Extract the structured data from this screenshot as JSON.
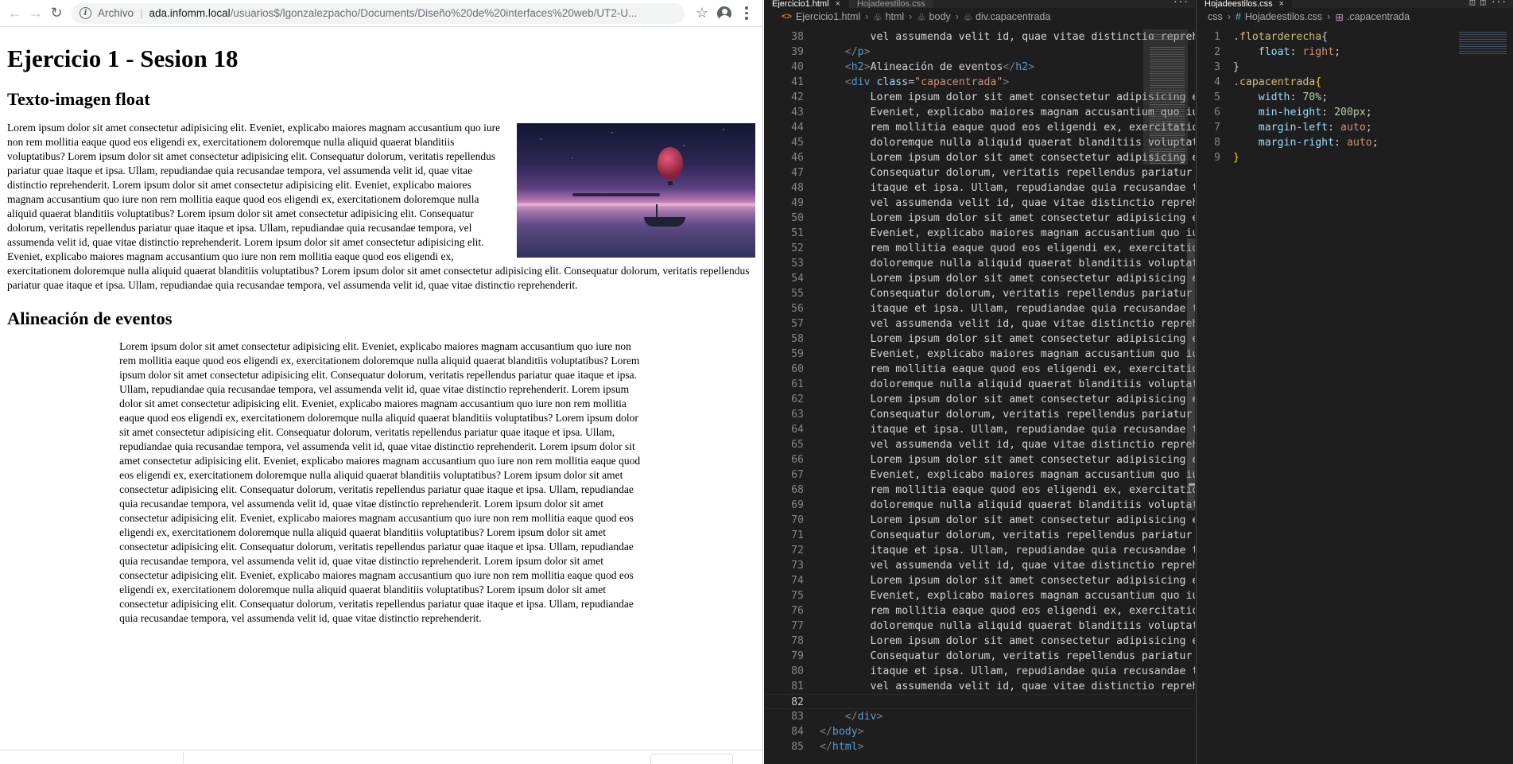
{
  "browser": {
    "scheme_label": "Archivo",
    "url_host": "ada.infomm.local",
    "url_path": "/usuarios$/lgonzalezpacho/Documents/Diseño%20de%20interfaces%20web/UT2-U...",
    "page": {
      "title": "Ejercicio 1 - Sesion 18",
      "section1_heading": "Texto-imagen float",
      "section1_text": "Lorem ipsum dolor sit amet consectetur adipisicing elit. Eveniet, explicabo maiores magnam accusantium quo iure non rem mollitia eaque quod eos eligendi ex, exercitationem doloremque nulla aliquid quaerat blanditiis voluptatibus? Lorem ipsum dolor sit amet consectetur adipisicing elit. Consequatur dolorum, veritatis repellendus pariatur quae itaque et ipsa. Ullam, repudiandae quia recusandae tempora, vel assumenda velit id, quae vitae distinctio reprehenderit. Lorem ipsum dolor sit amet consectetur adipisicing elit. Eveniet, explicabo maiores magnam accusantium quo iure non rem mollitia eaque quod eos eligendi ex, exercitationem doloremque nulla aliquid quaerat blanditiis voluptatibus? Lorem ipsum dolor sit amet consectetur adipisicing elit. Consequatur dolorum, veritatis repellendus pariatur quae itaque et ipsa. Ullam, repudiandae quia recusandae tempora, vel assumenda velit id, quae vitae distinctio reprehenderit. Lorem ipsum dolor sit amet consectetur adipisicing elit. Eveniet, explicabo maiores magnam accusantium quo iure non rem mollitia eaque quod eos eligendi ex, exercitationem doloremque nulla aliquid quaerat blanditiis voluptatibus? Lorem ipsum dolor sit amet consectetur adipisicing elit. Consequatur dolorum, veritatis repellendus pariatur quae itaque et ipsa. Ullam, repudiandae quia recusandae tempora, vel assumenda velit id, quae vitae distinctio reprehenderit.",
      "section2_heading": "Alineación de eventos",
      "section2_text": "Lorem ipsum dolor sit amet consectetur adipisicing elit. Eveniet, explicabo maiores magnam accusantium quo iure non rem mollitia eaque quod eos eligendi ex, exercitationem doloremque nulla aliquid quaerat blanditiis voluptatibus? Lorem ipsum dolor sit amet consectetur adipisicing elit. Consequatur dolorum, veritatis repellendus pariatur quae itaque et ipsa. Ullam, repudiandae quia recusandae tempora, vel assumenda velit id, quae vitae distinctio reprehenderit. Lorem ipsum dolor sit amet consectetur adipisicing elit. Eveniet, explicabo maiores magnam accusantium quo iure non rem mollitia eaque quod eos eligendi ex, exercitationem doloremque nulla aliquid quaerat blanditiis voluptatibus? Lorem ipsum dolor sit amet consectetur adipisicing elit. Consequatur dolorum, veritatis repellendus pariatur quae itaque et ipsa. Ullam, repudiandae quia recusandae tempora, vel assumenda velit id, quae vitae distinctio reprehenderit. Lorem ipsum dolor sit amet consectetur adipisicing elit. Eveniet, explicabo maiores magnam accusantium quo iure non rem mollitia eaque quod eos eligendi ex, exercitationem doloremque nulla aliquid quaerat blanditiis voluptatibus? Lorem ipsum dolor sit amet consectetur adipisicing elit. Consequatur dolorum, veritatis repellendus pariatur quae itaque et ipsa. Ullam, repudiandae quia recusandae tempora, vel assumenda velit id, quae vitae distinctio reprehenderit. Lorem ipsum dolor sit amet consectetur adipisicing elit. Eveniet, explicabo maiores magnam accusantium quo iure non rem mollitia eaque quod eos eligendi ex, exercitationem doloremque nulla aliquid quaerat blanditiis voluptatibus? Lorem ipsum dolor sit amet consectetur adipisicing elit. Consequatur dolorum, veritatis repellendus pariatur quae itaque et ipsa. Ullam, repudiandae quia recusandae tempora, vel assumenda velit id, quae vitae distinctio reprehenderit. Lorem ipsum dolor sit amet consectetur adipisicing elit. Eveniet, explicabo maiores magnam accusantium quo iure non rem mollitia eaque quod eos eligendi ex, exercitationem doloremque nulla aliquid quaerat blanditiis voluptatibus? Lorem ipsum dolor sit amet consectetur adipisicing elit. Consequatur dolorum, veritatis repellendus pariatur quae itaque et ipsa. Ullam, repudiandae quia recusandae tempora, vel assumenda velit id, quae vitae distinctio reprehenderit."
    }
  },
  "editor_left": {
    "tabs": [
      {
        "label": "Ejercicio1.html",
        "active": true
      },
      {
        "label": "Hojadeestilos.css",
        "active": false
      }
    ],
    "breadcrumb": {
      "file": "Ejercicio1.html",
      "c1": "html",
      "c2": "body",
      "c3": "div.capacentrada"
    },
    "lines": [
      {
        "n": "38",
        "tokens": [
          [
            "        vel assumenda velit id, quae vitae distinctio reprehenderit.",
            ""
          ]
        ]
      },
      {
        "n": "39",
        "tokens": [
          [
            "    ",
            ""
          ],
          [
            "</",
            "punc"
          ],
          [
            "p",
            "tag"
          ],
          [
            ">",
            "punc"
          ]
        ]
      },
      {
        "n": "40",
        "tokens": [
          [
            "    ",
            ""
          ],
          [
            "<",
            "punc"
          ],
          [
            "h2",
            "tag"
          ],
          [
            ">",
            "punc"
          ],
          [
            "Alineación de eventos",
            ""
          ],
          [
            "</",
            "punc"
          ],
          [
            "h2",
            "tag"
          ],
          [
            ">",
            "punc"
          ]
        ]
      },
      {
        "n": "41",
        "tokens": [
          [
            "    ",
            ""
          ],
          [
            "<",
            "punc"
          ],
          [
            "div",
            "tag"
          ],
          [
            " class",
            "attr"
          ],
          [
            "=",
            ""
          ],
          [
            "\"capacentrada\"",
            "str"
          ],
          [
            ">",
            "punc"
          ]
        ]
      },
      {
        "n": "42",
        "tokens": [
          [
            "        Lorem ipsum dolor sit amet consectetur adipisicing elit.",
            ""
          ]
        ]
      },
      {
        "n": "43",
        "tokens": [
          [
            "        Eveniet, explicabo maiores magnam accusantium quo iure non",
            ""
          ]
        ]
      },
      {
        "n": "44",
        "tokens": [
          [
            "        rem mollitia eaque quod eos eligendi ex, exercitationem",
            ""
          ]
        ]
      },
      {
        "n": "45",
        "tokens": [
          [
            "        doloremque nulla aliquid quaerat blanditiis voluptatibus?",
            ""
          ]
        ]
      },
      {
        "n": "46",
        "tokens": [
          [
            "        Lorem ipsum dolor sit amet consectetur adipisicing elit.",
            ""
          ]
        ]
      },
      {
        "n": "47",
        "tokens": [
          [
            "        Consequatur dolorum, veritatis repellendus pariatur quae",
            ""
          ]
        ]
      },
      {
        "n": "48",
        "tokens": [
          [
            "        itaque et ipsa. Ullam, repudiandae quia recusandae tempora,",
            ""
          ]
        ]
      },
      {
        "n": "49",
        "tokens": [
          [
            "        vel assumenda velit id, quae vitae distinctio reprehenderit.",
            ""
          ]
        ]
      },
      {
        "n": "50",
        "tokens": [
          [
            "        Lorem ipsum dolor sit amet consectetur adipisicing elit.",
            ""
          ]
        ]
      },
      {
        "n": "51",
        "tokens": [
          [
            "        Eveniet, explicabo maiores magnam accusantium quo iure non",
            ""
          ]
        ]
      },
      {
        "n": "52",
        "tokens": [
          [
            "        rem mollitia eaque quod eos eligendi ex, exercitationem",
            ""
          ]
        ]
      },
      {
        "n": "53",
        "tokens": [
          [
            "        doloremque nulla aliquid quaerat blanditiis voluptatibus?",
            ""
          ]
        ]
      },
      {
        "n": "54",
        "tokens": [
          [
            "        Lorem ipsum dolor sit amet consectetur adipisicing elit.",
            ""
          ]
        ]
      },
      {
        "n": "55",
        "tokens": [
          [
            "        Consequatur dolorum, veritatis repellendus pariatur quae",
            ""
          ]
        ]
      },
      {
        "n": "56",
        "tokens": [
          [
            "        itaque et ipsa. Ullam, repudiandae quia recusandae tempora,",
            ""
          ]
        ]
      },
      {
        "n": "57",
        "tokens": [
          [
            "        vel assumenda velit id, quae vitae distinctio reprehenderit.",
            ""
          ]
        ]
      },
      {
        "n": "58",
        "tokens": [
          [
            "        Lorem ipsum dolor sit amet consectetur adipisicing elit.",
            ""
          ]
        ]
      },
      {
        "n": "59",
        "tokens": [
          [
            "        Eveniet, explicabo maiores magnam accusantium quo iure non",
            ""
          ]
        ]
      },
      {
        "n": "60",
        "tokens": [
          [
            "        rem mollitia eaque quod eos eligendi ex, exercitationem",
            ""
          ]
        ]
      },
      {
        "n": "61",
        "tokens": [
          [
            "        doloremque nulla aliquid quaerat blanditiis voluptatibus?",
            ""
          ]
        ]
      },
      {
        "n": "62",
        "tokens": [
          [
            "        Lorem ipsum dolor sit amet consectetur adipisicing elit.",
            ""
          ]
        ]
      },
      {
        "n": "63",
        "tokens": [
          [
            "        Consequatur dolorum, veritatis repellendus pariatur quae",
            ""
          ]
        ]
      },
      {
        "n": "64",
        "tokens": [
          [
            "        itaque et ipsa. Ullam, repudiandae quia recusandae tempora,",
            ""
          ]
        ]
      },
      {
        "n": "65",
        "tokens": [
          [
            "        vel assumenda velit id, quae vitae distinctio reprehenderit.",
            ""
          ]
        ]
      },
      {
        "n": "66",
        "tokens": [
          [
            "        Lorem ipsum dolor sit amet consectetur adipisicing elit.",
            ""
          ]
        ]
      },
      {
        "n": "67",
        "tokens": [
          [
            "        Eveniet, explicabo maiores magnam accusantium quo iure non",
            ""
          ]
        ]
      },
      {
        "n": "68",
        "tokens": [
          [
            "        rem mollitia eaque quod eos eligendi ex, exercitationem",
            ""
          ]
        ]
      },
      {
        "n": "69",
        "tokens": [
          [
            "        doloremque nulla aliquid quaerat blanditiis voluptatibus?",
            ""
          ]
        ]
      },
      {
        "n": "70",
        "tokens": [
          [
            "        Lorem ipsum dolor sit amet consectetur adipisicing elit.",
            ""
          ]
        ]
      },
      {
        "n": "71",
        "tokens": [
          [
            "        Consequatur dolorum, veritatis repellendus pariatur quae",
            ""
          ]
        ]
      },
      {
        "n": "72",
        "tokens": [
          [
            "        itaque et ipsa. Ullam, repudiandae quia recusandae tempora,",
            ""
          ]
        ]
      },
      {
        "n": "73",
        "tokens": [
          [
            "        vel assumenda velit id, quae vitae distinctio reprehenderit.",
            ""
          ]
        ]
      },
      {
        "n": "74",
        "tokens": [
          [
            "        Lorem ipsum dolor sit amet consectetur adipisicing elit.",
            ""
          ]
        ]
      },
      {
        "n": "75",
        "tokens": [
          [
            "        Eveniet, explicabo maiores magnam accusantium quo iure non",
            ""
          ]
        ]
      },
      {
        "n": "76",
        "tokens": [
          [
            "        rem mollitia eaque quod eos eligendi ex, exercitationem",
            ""
          ]
        ]
      },
      {
        "n": "77",
        "tokens": [
          [
            "        doloremque nulla aliquid quaerat blanditiis voluptatibus?",
            ""
          ]
        ]
      },
      {
        "n": "78",
        "tokens": [
          [
            "        Lorem ipsum dolor sit amet consectetur adipisicing elit.",
            ""
          ]
        ]
      },
      {
        "n": "79",
        "tokens": [
          [
            "        Consequatur dolorum, veritatis repellendus pariatur quae",
            ""
          ]
        ]
      },
      {
        "n": "80",
        "tokens": [
          [
            "        itaque et ipsa. Ullam, repudiandae quia recusandae tempora,",
            ""
          ]
        ]
      },
      {
        "n": "81",
        "tokens": [
          [
            "        vel assumenda velit id, quae vitae distinctio reprehenderit.",
            ""
          ]
        ]
      },
      {
        "n": "82",
        "tokens": [
          [
            "",
            ""
          ]
        ],
        "current": true
      },
      {
        "n": "83",
        "tokens": [
          [
            "    ",
            ""
          ],
          [
            "</",
            "punc"
          ],
          [
            "div",
            "tag"
          ],
          [
            ">",
            "punc"
          ]
        ]
      },
      {
        "n": "84",
        "tokens": [
          [
            "",
            ""
          ],
          [
            "</",
            "punc"
          ],
          [
            "body",
            "tag"
          ],
          [
            ">",
            "punc"
          ]
        ]
      },
      {
        "n": "85",
        "tokens": [
          [
            "",
            ""
          ],
          [
            "</",
            "punc"
          ],
          [
            "html",
            "tag"
          ],
          [
            ">",
            "punc"
          ]
        ]
      }
    ]
  },
  "editor_right": {
    "tabs": [
      {
        "label": "Hojadeestilos.css",
        "active": true
      }
    ],
    "breadcrumb": {
      "c0": "css",
      "file": "Hojadeestilos.css",
      "c1": ".capacentrada"
    },
    "lines": [
      {
        "n": "1",
        "tokens": [
          [
            ".flotarderecha",
            "sel"
          ],
          [
            "{",
            ""
          ]
        ]
      },
      {
        "n": "2",
        "tokens": [
          [
            "    ",
            ""
          ],
          [
            "float",
            "prop"
          ],
          [
            ": ",
            ""
          ],
          [
            "right",
            "val"
          ],
          [
            ";",
            ""
          ]
        ]
      },
      {
        "n": "3",
        "tokens": [
          [
            "}",
            ""
          ]
        ]
      },
      {
        "n": "4",
        "tokens": [
          [
            ".capacentrada",
            "sel"
          ],
          [
            "{",
            "brace"
          ]
        ]
      },
      {
        "n": "5",
        "tokens": [
          [
            "    ",
            ""
          ],
          [
            "width",
            "prop"
          ],
          [
            ": ",
            ""
          ],
          [
            "70%",
            "num"
          ],
          [
            ";",
            ""
          ]
        ]
      },
      {
        "n": "6",
        "tokens": [
          [
            "    ",
            ""
          ],
          [
            "min-height",
            "prop"
          ],
          [
            ": ",
            ""
          ],
          [
            "200px",
            "num"
          ],
          [
            ";",
            ""
          ]
        ]
      },
      {
        "n": "7",
        "tokens": [
          [
            "    ",
            ""
          ],
          [
            "margin-left",
            "prop"
          ],
          [
            ": ",
            ""
          ],
          [
            "auto",
            "val"
          ],
          [
            ";",
            ""
          ]
        ]
      },
      {
        "n": "8",
        "tokens": [
          [
            "    ",
            ""
          ],
          [
            "margin-right",
            "prop"
          ],
          [
            ": ",
            ""
          ],
          [
            "auto",
            "val"
          ],
          [
            ";",
            ""
          ]
        ]
      },
      {
        "n": "9",
        "tokens": [
          [
            "}",
            "brace"
          ]
        ]
      }
    ]
  },
  "colors": {
    "editor_bg": "#1e1e1e",
    "tag": "#569cd6",
    "attr": "#9cdcfe",
    "string": "#ce9178",
    "selector": "#d7ba7d",
    "number": "#b5cea8"
  },
  "icons": {
    "back": "arrow-left-icon",
    "forward": "arrow-right-icon",
    "reload": "reload-icon",
    "info": "info-icon",
    "star": "star-icon",
    "account": "account-icon",
    "menu": "kebab-menu-icon"
  }
}
